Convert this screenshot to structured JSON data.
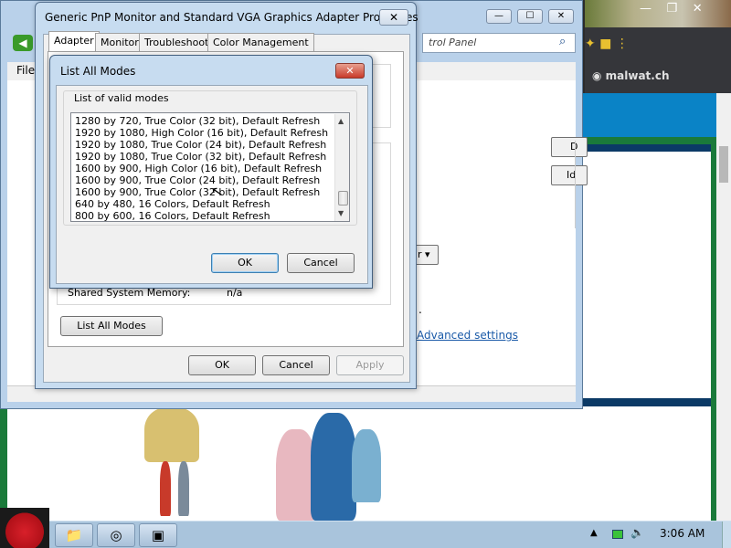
{
  "browser": {
    "bookmark_site": "malwat.ch",
    "controls": [
      "—",
      "❐",
      "✕"
    ],
    "extension_icons": "✦ ■ ⋮"
  },
  "control_panel": {
    "address_text": "trol Panel",
    "menu_file": "File",
    "side_buttons": [
      "D",
      "Id"
    ],
    "dropdown": "r ▾",
    "period": ".",
    "advanced_link": "Advanced settings",
    "window_controls": [
      "—",
      "☐",
      "✕"
    ]
  },
  "properties": {
    "title": "Generic PnP Monitor and Standard VGA Graphics Adapter Properties",
    "close": "✕",
    "tabs": [
      "Adapter",
      "Monitor",
      "Troubleshoot",
      "Color Management"
    ],
    "shared_memory_label": "Shared System Memory:",
    "shared_memory_value": "n/a",
    "list_all_button": "List All Modes",
    "ok": "OK",
    "cancel": "Cancel",
    "apply": "Apply"
  },
  "modes_dialog": {
    "title": "List All Modes",
    "close": "✕",
    "group_label": "List of valid modes",
    "items": [
      "1280 by 720, True Color (32 bit), Default Refresh",
      "1920 by 1080, High Color (16 bit), Default Refresh",
      "1920 by 1080, True Color (24 bit), Default Refresh",
      "1920 by 1080, True Color (32 bit), Default Refresh",
      "1600 by 900, High Color (16 bit), Default Refresh",
      "1600 by 900, True Color (24 bit), Default Refresh",
      "1600 by 900, True Color (32 bit), Default Refresh",
      "640 by 480, 16 Colors, Default Refresh",
      "800 by 600, 16 Colors, Default Refresh"
    ],
    "ok": "OK",
    "cancel": "Cancel"
  },
  "taskbar": {
    "clock": "3:06 AM",
    "tray_arrow": "▲",
    "volume": "🔈"
  }
}
